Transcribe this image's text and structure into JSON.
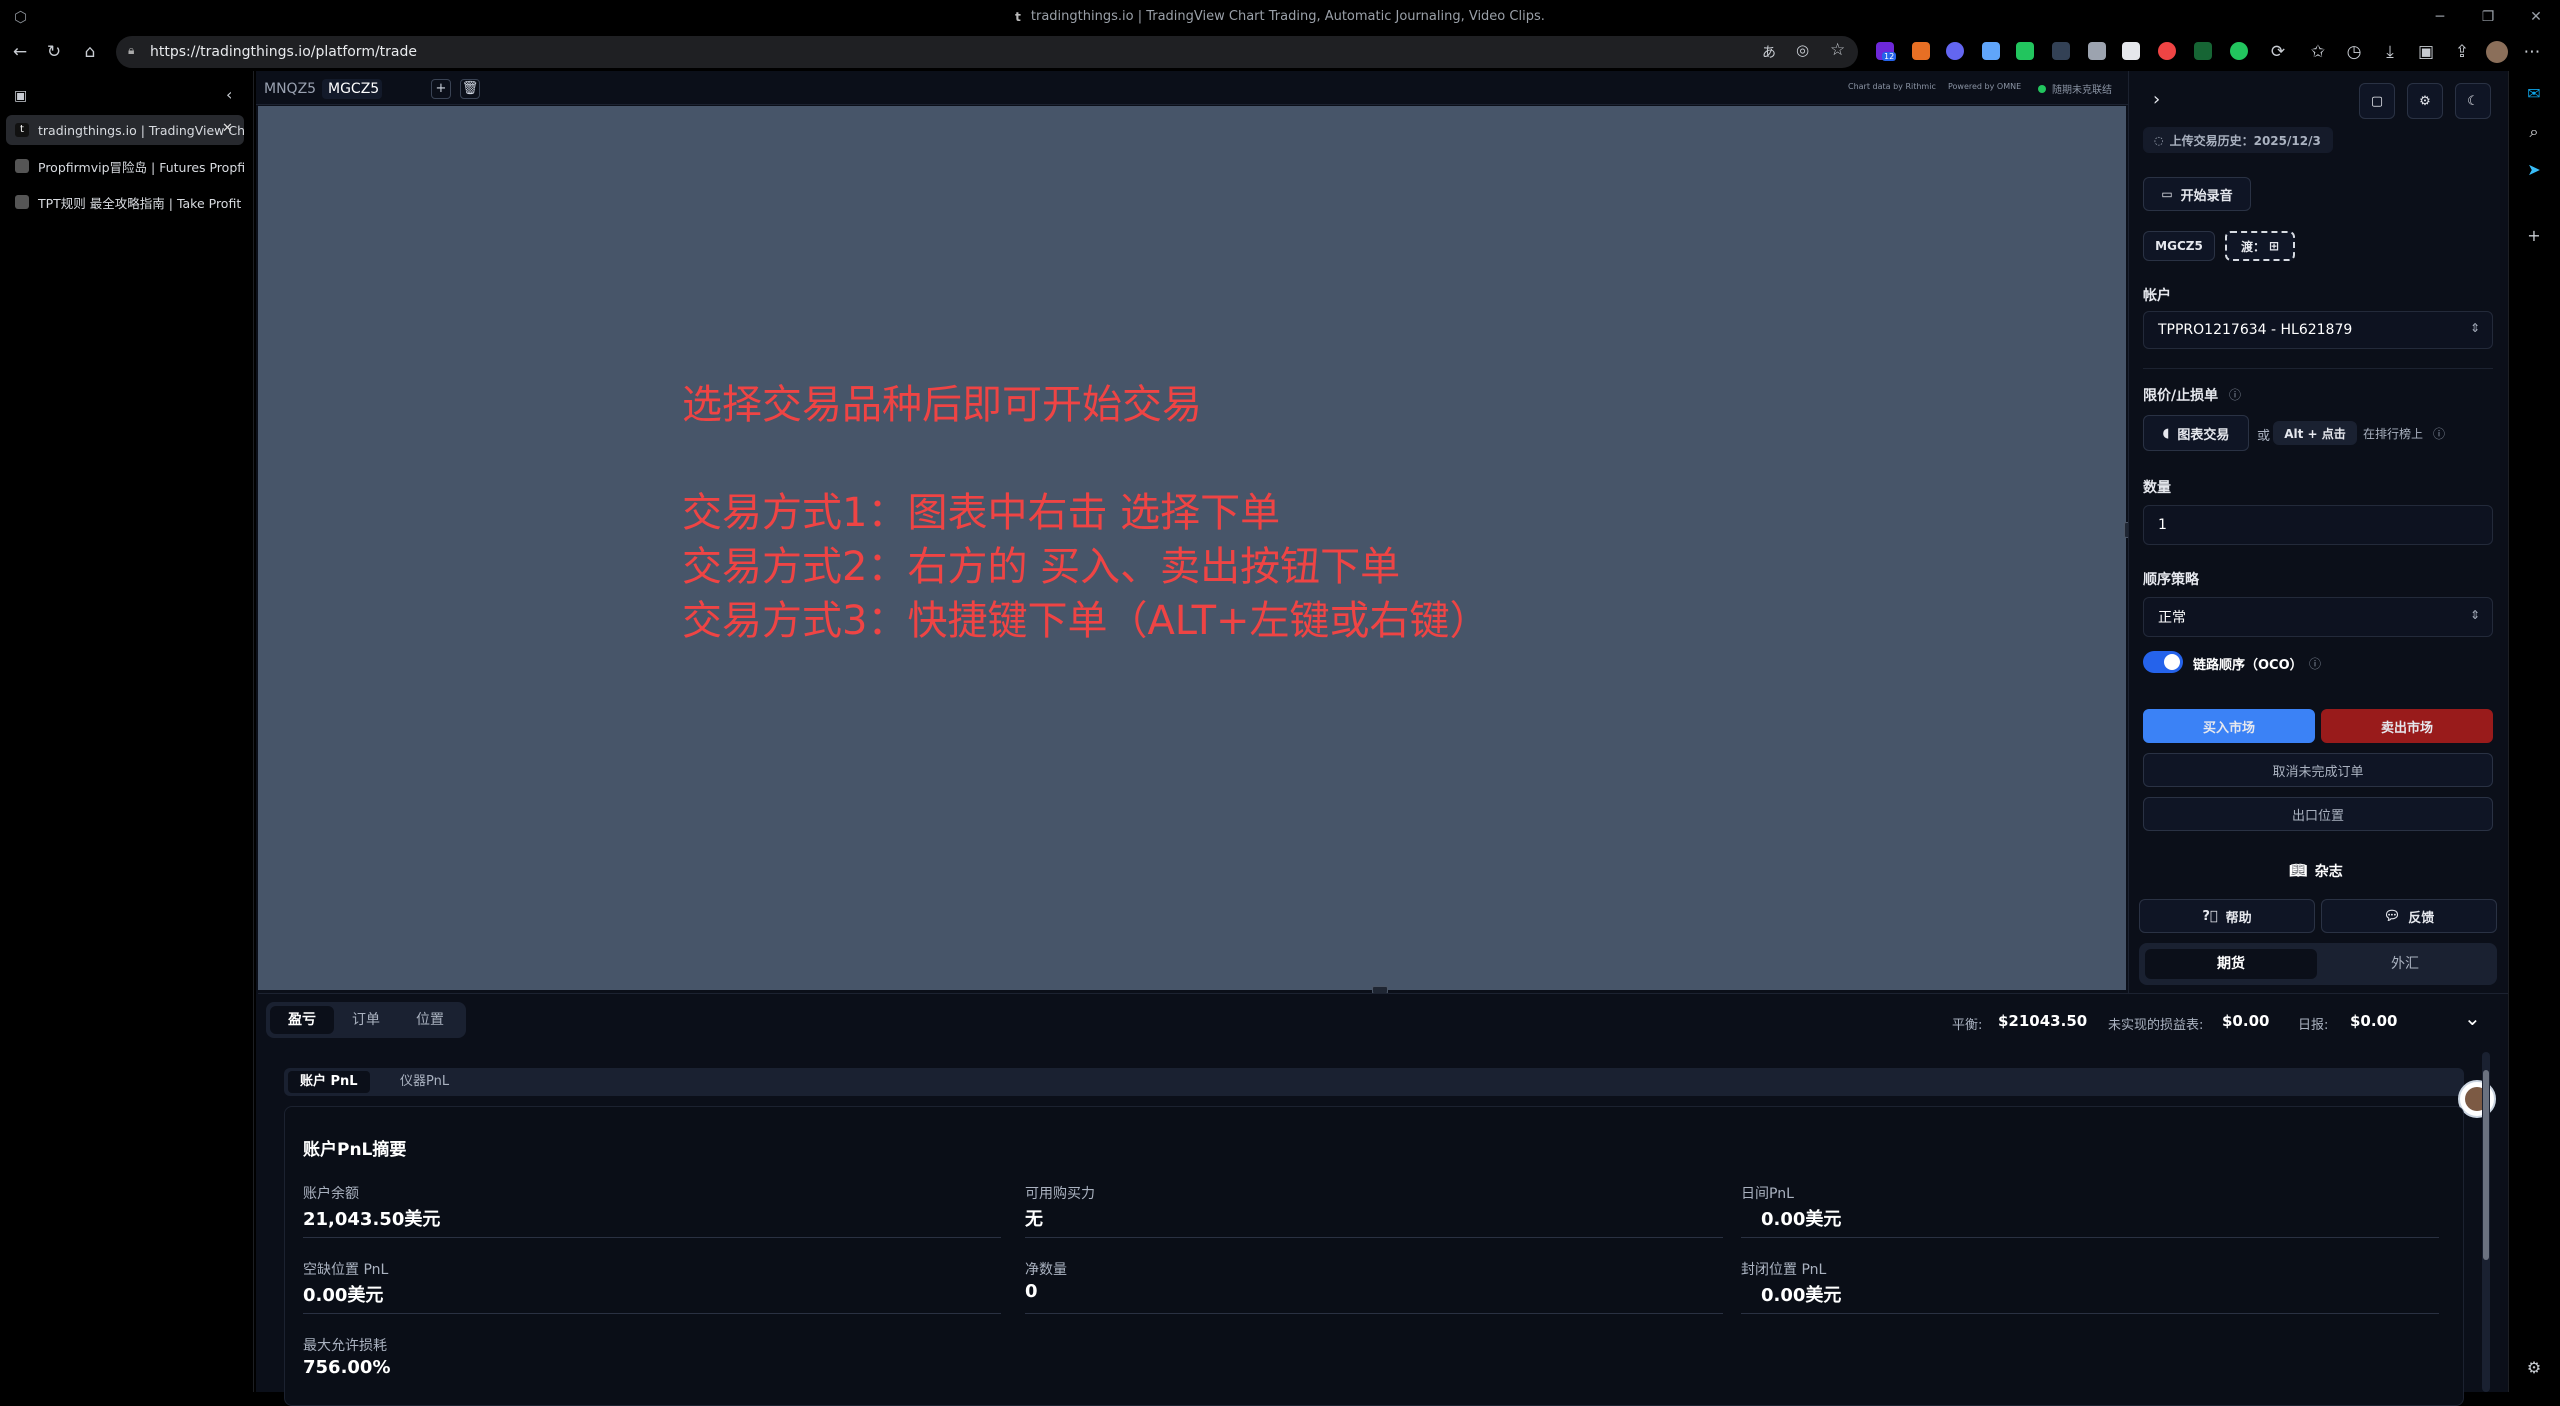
{
  "window": {
    "title": "tradingthings.io | TradingView Chart Trading, Automatic Journaling, Video Clips.",
    "favicon_glyph": "t"
  },
  "browser": {
    "url": "https://tradingthings.io/platform/trade",
    "ext_badge": "12"
  },
  "vertical_tabs": [
    {
      "title": "tradingthings.io | TradingView Ch",
      "active": true
    },
    {
      "title": "Propfirmvip冒险岛 | Futures Propfirm"
    },
    {
      "title": "TPT规则 最全攻略指南 | Take Profit Tr"
    }
  ],
  "chart_tabs": [
    "MNQZ5",
    "MGCZ5"
  ],
  "chart_tab_add": "+",
  "chart_header_right": {
    "text1": "Chart data by Rithmic",
    "text2": "Powered by OMNE",
    "status": "随期未克联结"
  },
  "overlay_text": {
    "line1": "选择交易品种后即可开始交易",
    "line2": "交易方式1：图表中右击  选择下单",
    "line3": "交易方式2：右方的 买入、卖出按钮下单",
    "line4": "交易方式3：快捷键下单（ALT+左键或右键）"
  },
  "right_panel": {
    "upload_history": "上传交易历史：2025/12/3",
    "start_recording": "开始录音",
    "symbol_chip": "MGCZ5",
    "add_chip": "渡：",
    "account_label": "帐户",
    "account_value": "TPPRO1217634 - HL621879",
    "limit_stop_label": "限价/止损单",
    "chart_trade_btn": "图表交易",
    "or_text": "或",
    "alt_click": "Alt + 点击",
    "on_ladder": "在排行榜上",
    "qty_label": "数量",
    "qty_value": "1",
    "order_strategy_label": "顺序策略",
    "order_strategy_value": "正常",
    "oco_label": "链路顺序（OCO）",
    "buy_market": "买入市场",
    "sell_market": "卖出市场",
    "cancel_orders": "取消未完成订单",
    "exit_position": "出口位置",
    "journal": "杂志",
    "help": "帮助",
    "feedback": "反馈",
    "futures_tab": "期货",
    "forex_tab": "外汇"
  },
  "bottom": {
    "tabs": [
      "盈亏",
      "订单",
      "位置"
    ],
    "balance_label": "平衡:",
    "balance_value": "$21043.50",
    "unrealized_label": "未实现的损益表:",
    "unrealized_value": "$0.00",
    "daily_label": "日报:",
    "daily_value": "$0.00",
    "sub_tabs": [
      "账户 PnL",
      "仪器PnL"
    ],
    "summary_title": "账户PnL摘要",
    "fields": [
      {
        "label": "账户余额",
        "value": "21,043.50美元"
      },
      {
        "label": "可用购买力",
        "value": "无"
      },
      {
        "label": "日间PnL",
        "value": "0.00美元"
      },
      {
        "label": "空缺位置 PnL",
        "value": "0.00美元"
      },
      {
        "label": "净数量",
        "value": "0"
      },
      {
        "label": "封闭位置 PnL",
        "value": "0.00美元"
      },
      {
        "label": "最大允许损耗",
        "value": "756.00%"
      }
    ]
  },
  "colors": {
    "chart_bg": "#475569",
    "overlay_text": "#ef4444",
    "buy": "#3b82f6",
    "sell": "#991b1b",
    "app_bg": "#0b0f19"
  }
}
